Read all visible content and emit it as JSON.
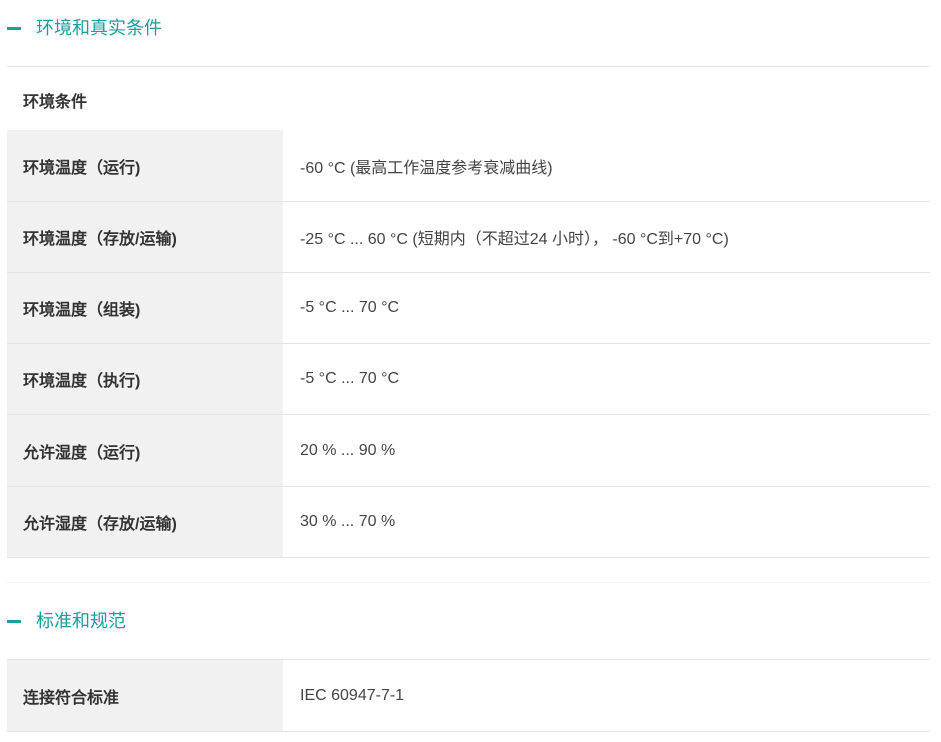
{
  "sections": [
    {
      "title": "环境和真实条件",
      "group_title": "环境条件",
      "rows": [
        {
          "label": "环境温度（运行)",
          "value": "-60 °C (最高工作温度参考衰减曲线)"
        },
        {
          "label": "环境温度（存放/运输)",
          "value": "-25 °C ... 60 °C (短期内（不超过24  小时），  -60 °C到+70 °C)"
        },
        {
          "label": "环境温度（组装)",
          "value": "-5 °C ... 70 °C"
        },
        {
          "label": "环境温度（执行)",
          "value": "-5 °C ... 70 °C"
        },
        {
          "label": "允许湿度（运行)",
          "value": "20 % ... 90 %"
        },
        {
          "label": "允许湿度（存放/运输)",
          "value": "30 % ... 70 %"
        }
      ]
    },
    {
      "title": "标准和规范",
      "rows": [
        {
          "label": "连接符合标准",
          "value": "IEC 60947-7-1"
        }
      ]
    }
  ],
  "colors": {
    "accent": "#1a9e9a",
    "label_bg": "#f1f1f1",
    "divider": "#e3e3e3"
  }
}
